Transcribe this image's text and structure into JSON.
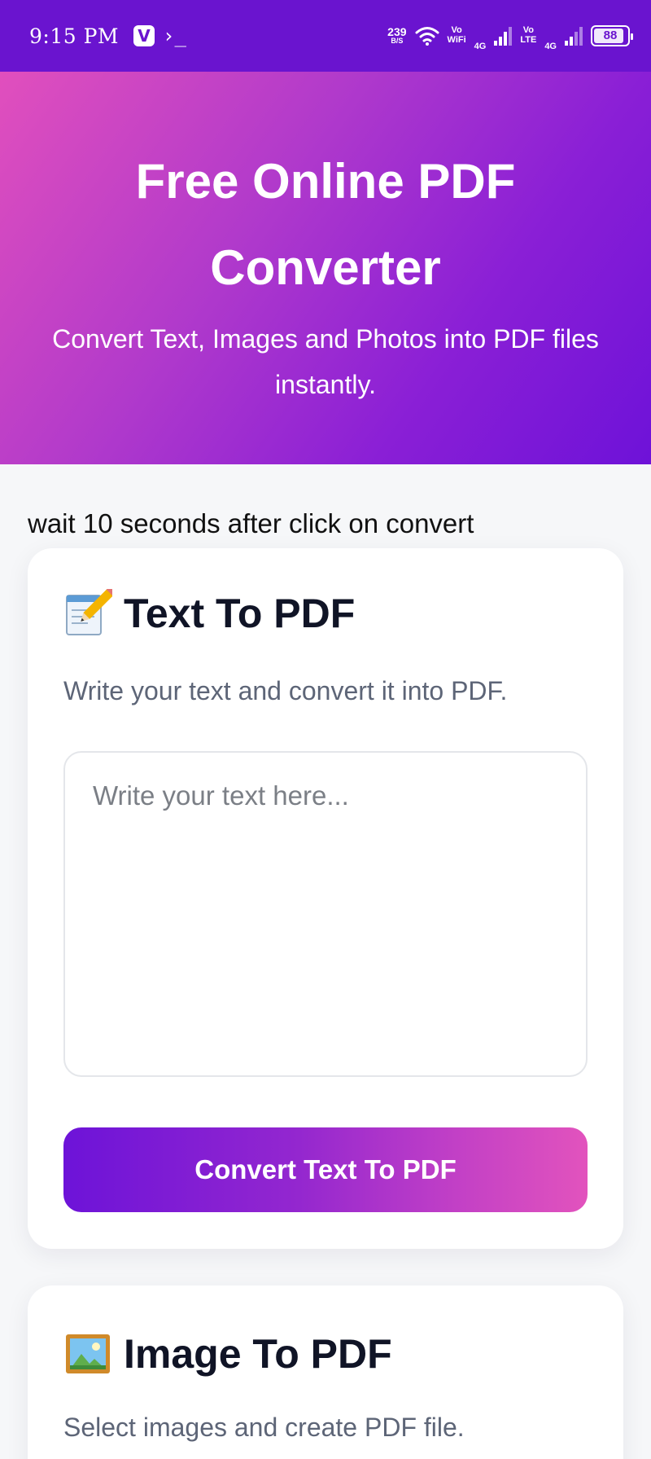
{
  "status_bar": {
    "time": "9:15 PM",
    "app_badge": "V",
    "terminal_glyph": "›_",
    "net_speed": "239",
    "net_speed_unit": "B/S",
    "vowifi": [
      "Vo",
      "WiFi"
    ],
    "volte": [
      "Vo",
      "LTE"
    ],
    "net_type_1": "4G",
    "net_type_2": "4G",
    "battery": "88"
  },
  "hero": {
    "title": "Free Online PDF Converter",
    "subtitle": "Convert Text, Images and Photos into PDF files instantly."
  },
  "notice": "wait 10 seconds after click on convert",
  "text_card": {
    "icon": "memo-pencil-icon",
    "title": "Text To PDF",
    "description": "Write your text and convert it into PDF.",
    "textarea_value": "",
    "textarea_placeholder": "Write your text here...",
    "button_label": "Convert Text To PDF"
  },
  "image_card": {
    "icon": "framed-picture-icon",
    "title": "Image To PDF",
    "description": "Select images and create PDF file."
  },
  "colors": {
    "status_bar": "#6a14cf",
    "hero_gradient_start": "#e14fbd",
    "hero_gradient_end": "#6e12d8",
    "button_gradient_start": "#6d13d8",
    "button_gradient_end": "#e253bd",
    "page_background": "#f6f7f9"
  }
}
